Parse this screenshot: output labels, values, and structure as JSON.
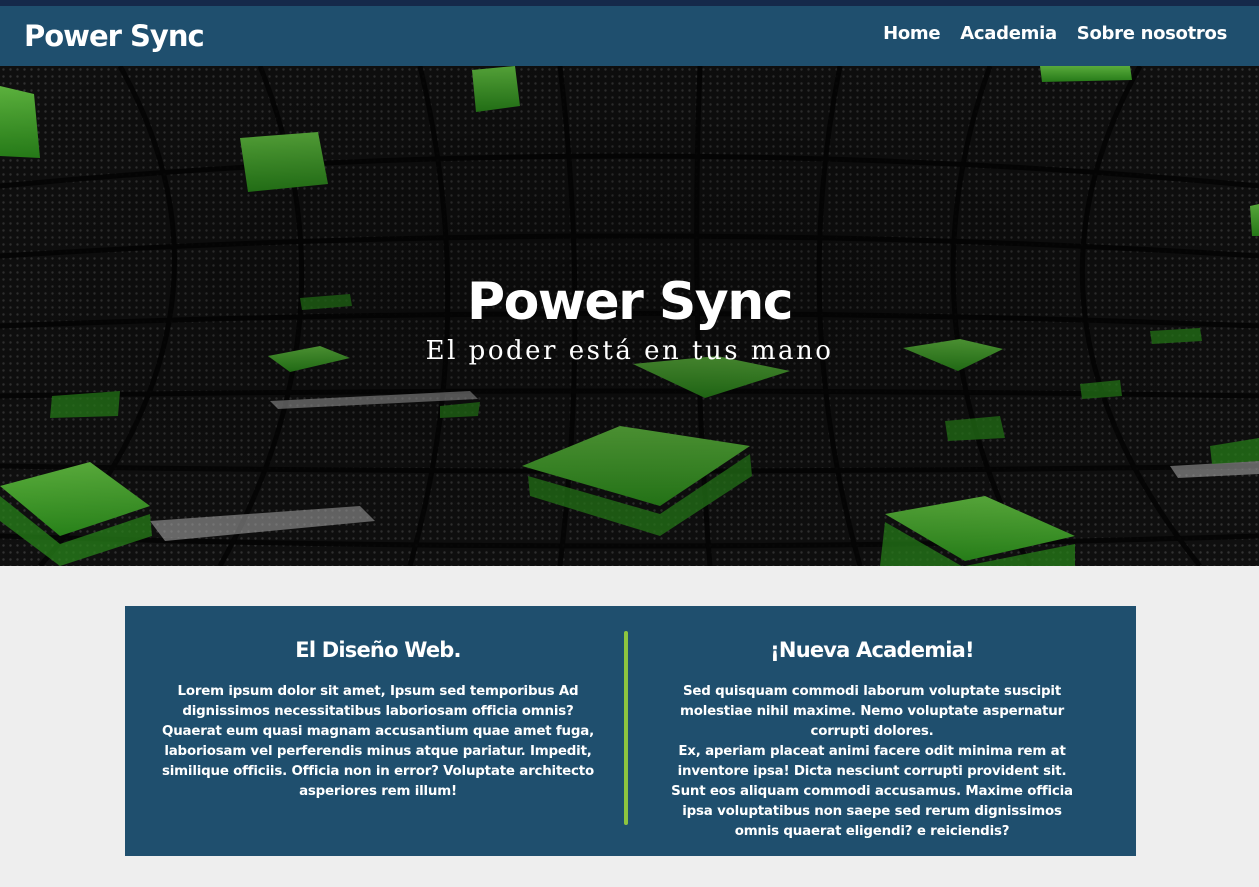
{
  "nav": {
    "brand": "Power Sync",
    "links": [
      "Home",
      "Academia",
      "Sobre nosotros"
    ]
  },
  "hero": {
    "title": "Power Sync",
    "subtitle": "El poder está en tus mano"
  },
  "sections": [
    {
      "title": "El Diseño Web.",
      "text": "Lorem ipsum dolor sit amet, Ipsum sed temporibus Ad dignissimos necessitatibus laboriosam officia omnis? Quaerat eum quasi magnam accusantium quae amet fuga, laboriosam vel perferendis minus atque pariatur. Impedit, similique officiis. Officia non in error? Voluptate architecto asperiores rem illum!"
    },
    {
      "title": "¡Nueva Academia!",
      "text1": "Sed quisquam commodi laborum voluptate suscipit molestiae nihil maxime. Nemo voluptate aspernatur corrupti dolores.",
      "text2": "Ex, aperiam placeat animi facere odit minima rem at inventore ipsa! Dicta nesciunt corrupti provident sit. Sunt eos aliquam commodi accusamus. Maxime officia ipsa voluptatibus non saepe sed rerum dignissimos omnis quaerat eligendi? e reiciendis?"
    }
  ],
  "colors": {
    "navbar": "#1f4f6e",
    "card": "#1f4f6e",
    "accent": "#8dc43f",
    "page_background": "#eeeeee"
  }
}
